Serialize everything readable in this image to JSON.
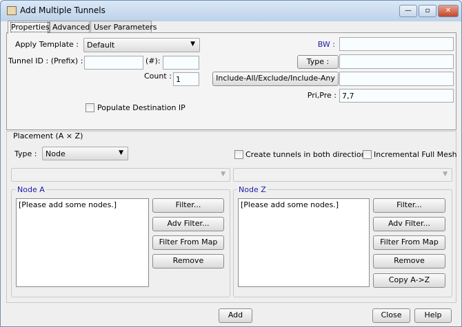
{
  "window": {
    "title": "Add Multiple Tunnels",
    "controls": {
      "minimize": "—",
      "maximize": "▫",
      "close": "✕"
    }
  },
  "tabs": [
    {
      "label": "Properties",
      "active": true
    },
    {
      "label": "Advanced"
    },
    {
      "label": "User Parameters"
    }
  ],
  "properties": {
    "apply_template_label": "Apply Template :",
    "apply_template_value": "Default",
    "tunnel_id_label": "Tunnel ID :  (Prefix) :",
    "prefix_value": "",
    "hash_label": "(#):",
    "hash_value": "",
    "count_label": "Count :",
    "count_value": "1",
    "populate_label": "Populate Destination IP",
    "populate_checked": false,
    "bw_label": "BW :",
    "bw_value": "",
    "type_button": "Type :",
    "type_value": "",
    "include_button": "Include-All/Exclude/Include-Any",
    "include_value": "",
    "pripre_label": "Pri,Pre :",
    "pripre_value": "7,7"
  },
  "placement": {
    "title": "Placement (A × Z)",
    "type_label": "Type :",
    "type_value": "Node",
    "both_directions_label": "Create tunnels in both directions",
    "both_directions_checked": false,
    "full_mesh_label": "Incremental Full Mesh",
    "full_mesh_checked": false,
    "node_a": {
      "title": "Node A",
      "list_placeholder": "[Please add some nodes.]",
      "buttons": [
        "Filter...",
        "Adv Filter...",
        "Filter From Map",
        "Remove"
      ]
    },
    "node_z": {
      "title": "Node Z",
      "list_placeholder": "[Please add some nodes.]",
      "buttons": [
        "Filter...",
        "Adv Filter...",
        "Filter From Map",
        "Remove",
        "Copy A->Z"
      ]
    }
  },
  "footer": {
    "add": "Add",
    "close": "Close",
    "help": "Help"
  },
  "colors": {
    "label_blue": "#1a1aa6",
    "titlebar": "#c8daee"
  }
}
